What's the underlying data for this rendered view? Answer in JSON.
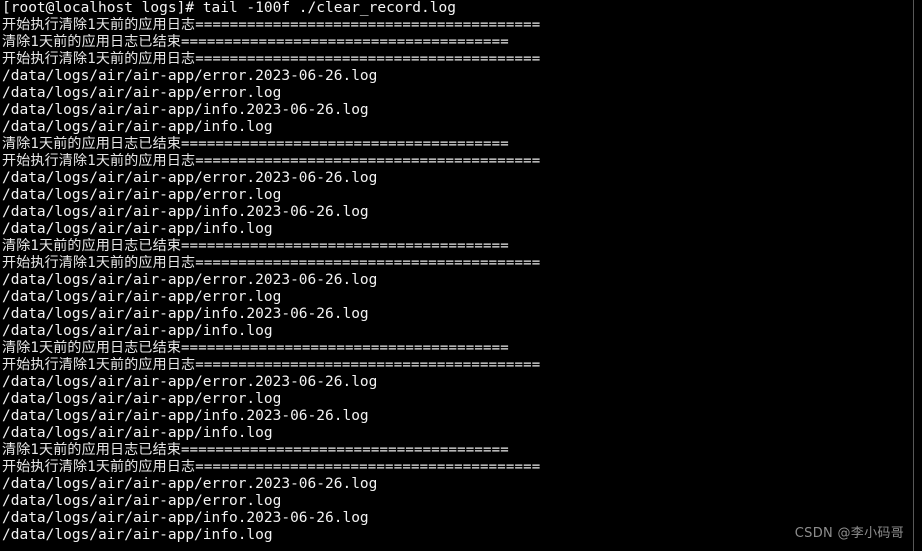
{
  "window": {
    "title": "root@localhost:/data/logs",
    "background_color": "#000000",
    "foreground_color": "#e8e8e8",
    "rule_color": "#585858"
  },
  "prompt": {
    "text": "[root@localhost logs]# tail -100f ./clear_record.log",
    "user_host": "[root@localhost logs]#",
    "command": "tail -100f ./clear_record.log"
  },
  "watermark": {
    "text": "CSDN @李小码哥",
    "color": "#8e8e8e"
  },
  "log": {
    "start_banner": "开始执行清除1天前的应用日志========================================",
    "end_banner": "清除1天前的应用日志已结束======================================",
    "paths": [
      "/data/logs/air/air-app/error.2023-06-26.log",
      "/data/logs/air/air-app/error.log",
      "/data/logs/air/air-app/info.2023-06-26.log",
      "/data/logs/air/air-app/info.log"
    ],
    "lines": [
      {
        "kind": "prompt",
        "text": "[root@localhost logs]# tail -100f ./clear_record.log"
      },
      {
        "kind": "cjk",
        "text": "开始执行清除1天前的应用日志========================================"
      },
      {
        "kind": "cjk",
        "text": "清除1天前的应用日志已结束======================================"
      },
      {
        "kind": "cjk",
        "text": "开始执行清除1天前的应用日志========================================"
      },
      {
        "kind": "path",
        "text": "/data/logs/air/air-app/error.2023-06-26.log"
      },
      {
        "kind": "path",
        "text": "/data/logs/air/air-app/error.log"
      },
      {
        "kind": "path",
        "text": "/data/logs/air/air-app/info.2023-06-26.log"
      },
      {
        "kind": "path",
        "text": "/data/logs/air/air-app/info.log"
      },
      {
        "kind": "cjk",
        "text": "清除1天前的应用日志已结束======================================"
      },
      {
        "kind": "cjk",
        "text": "开始执行清除1天前的应用日志========================================"
      },
      {
        "kind": "path",
        "text": "/data/logs/air/air-app/error.2023-06-26.log"
      },
      {
        "kind": "path",
        "text": "/data/logs/air/air-app/error.log"
      },
      {
        "kind": "path",
        "text": "/data/logs/air/air-app/info.2023-06-26.log"
      },
      {
        "kind": "path",
        "text": "/data/logs/air/air-app/info.log"
      },
      {
        "kind": "cjk",
        "text": "清除1天前的应用日志已结束======================================"
      },
      {
        "kind": "cjk",
        "text": "开始执行清除1天前的应用日志========================================"
      },
      {
        "kind": "path",
        "text": "/data/logs/air/air-app/error.2023-06-26.log"
      },
      {
        "kind": "path",
        "text": "/data/logs/air/air-app/error.log"
      },
      {
        "kind": "path",
        "text": "/data/logs/air/air-app/info.2023-06-26.log"
      },
      {
        "kind": "path",
        "text": "/data/logs/air/air-app/info.log"
      },
      {
        "kind": "cjk",
        "text": "清除1天前的应用日志已结束======================================"
      },
      {
        "kind": "cjk",
        "text": "开始执行清除1天前的应用日志========================================"
      },
      {
        "kind": "path",
        "text": "/data/logs/air/air-app/error.2023-06-26.log"
      },
      {
        "kind": "path",
        "text": "/data/logs/air/air-app/error.log"
      },
      {
        "kind": "path",
        "text": "/data/logs/air/air-app/info.2023-06-26.log"
      },
      {
        "kind": "path",
        "text": "/data/logs/air/air-app/info.log"
      },
      {
        "kind": "cjk",
        "text": "清除1天前的应用日志已结束======================================"
      },
      {
        "kind": "cjk",
        "text": "开始执行清除1天前的应用日志========================================"
      },
      {
        "kind": "path",
        "text": "/data/logs/air/air-app/error.2023-06-26.log"
      },
      {
        "kind": "path",
        "text": "/data/logs/air/air-app/error.log"
      },
      {
        "kind": "path",
        "text": "/data/logs/air/air-app/info.2023-06-26.log"
      },
      {
        "kind": "path",
        "text": "/data/logs/air/air-app/info.log"
      }
    ]
  }
}
